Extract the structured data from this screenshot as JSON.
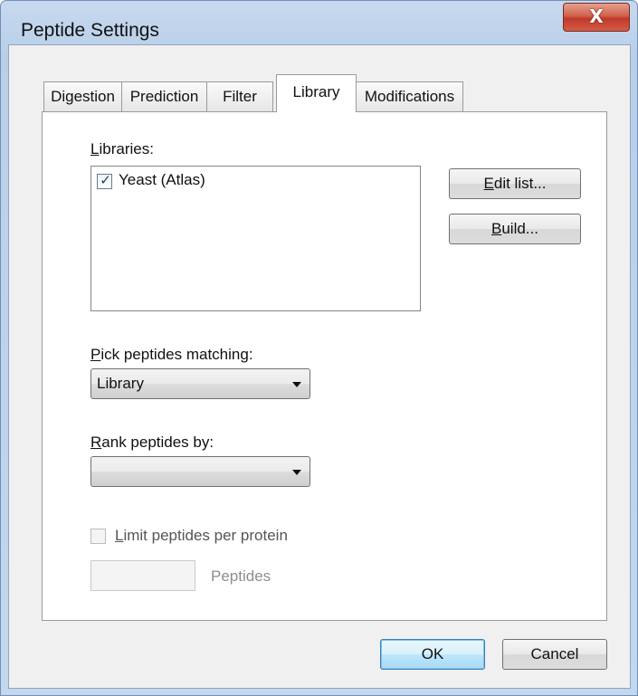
{
  "window": {
    "title": "Peptide Settings",
    "close_glyph": "X"
  },
  "tabs": [
    {
      "label": "Digestion",
      "selected": false
    },
    {
      "label": "Prediction",
      "selected": false
    },
    {
      "label": "Filter",
      "selected": false
    },
    {
      "label": "Library",
      "selected": true
    },
    {
      "label": "Modifications",
      "selected": false
    }
  ],
  "library_tab": {
    "libraries_label_hotkey": "L",
    "libraries_label_rest": "ibraries:",
    "libraries": [
      {
        "name": "Yeast (Atlas)",
        "checked": true,
        "check_glyph": "✓"
      }
    ],
    "edit_list_hotkey": "E",
    "edit_list_rest": "dit list...",
    "build_hotkey": "B",
    "build_rest": "uild...",
    "pick_label_hotkey": "P",
    "pick_label_rest": "ick peptides matching:",
    "pick_value": "Library",
    "rank_label_hotkey": "R",
    "rank_label_rest": "ank peptides by:",
    "rank_value": "",
    "limit_hotkey": "L",
    "limit_rest": "imit peptides per protein",
    "limit_checked": false,
    "limit_enabled": false,
    "peptides_count_value": "",
    "peptides_suffix": "Peptides"
  },
  "footer": {
    "ok_label": "OK",
    "cancel_label": "Cancel"
  },
  "colors": {
    "title_bar": "#c7d9ef",
    "close_button": "#c0392b",
    "dialog_face": "#f0f0f0",
    "default_button_border": "#3c7fb1"
  },
  "icons": {
    "close": "close-icon",
    "dropdown": "chevron-down-icon",
    "checkbox": "checkmark-icon"
  }
}
